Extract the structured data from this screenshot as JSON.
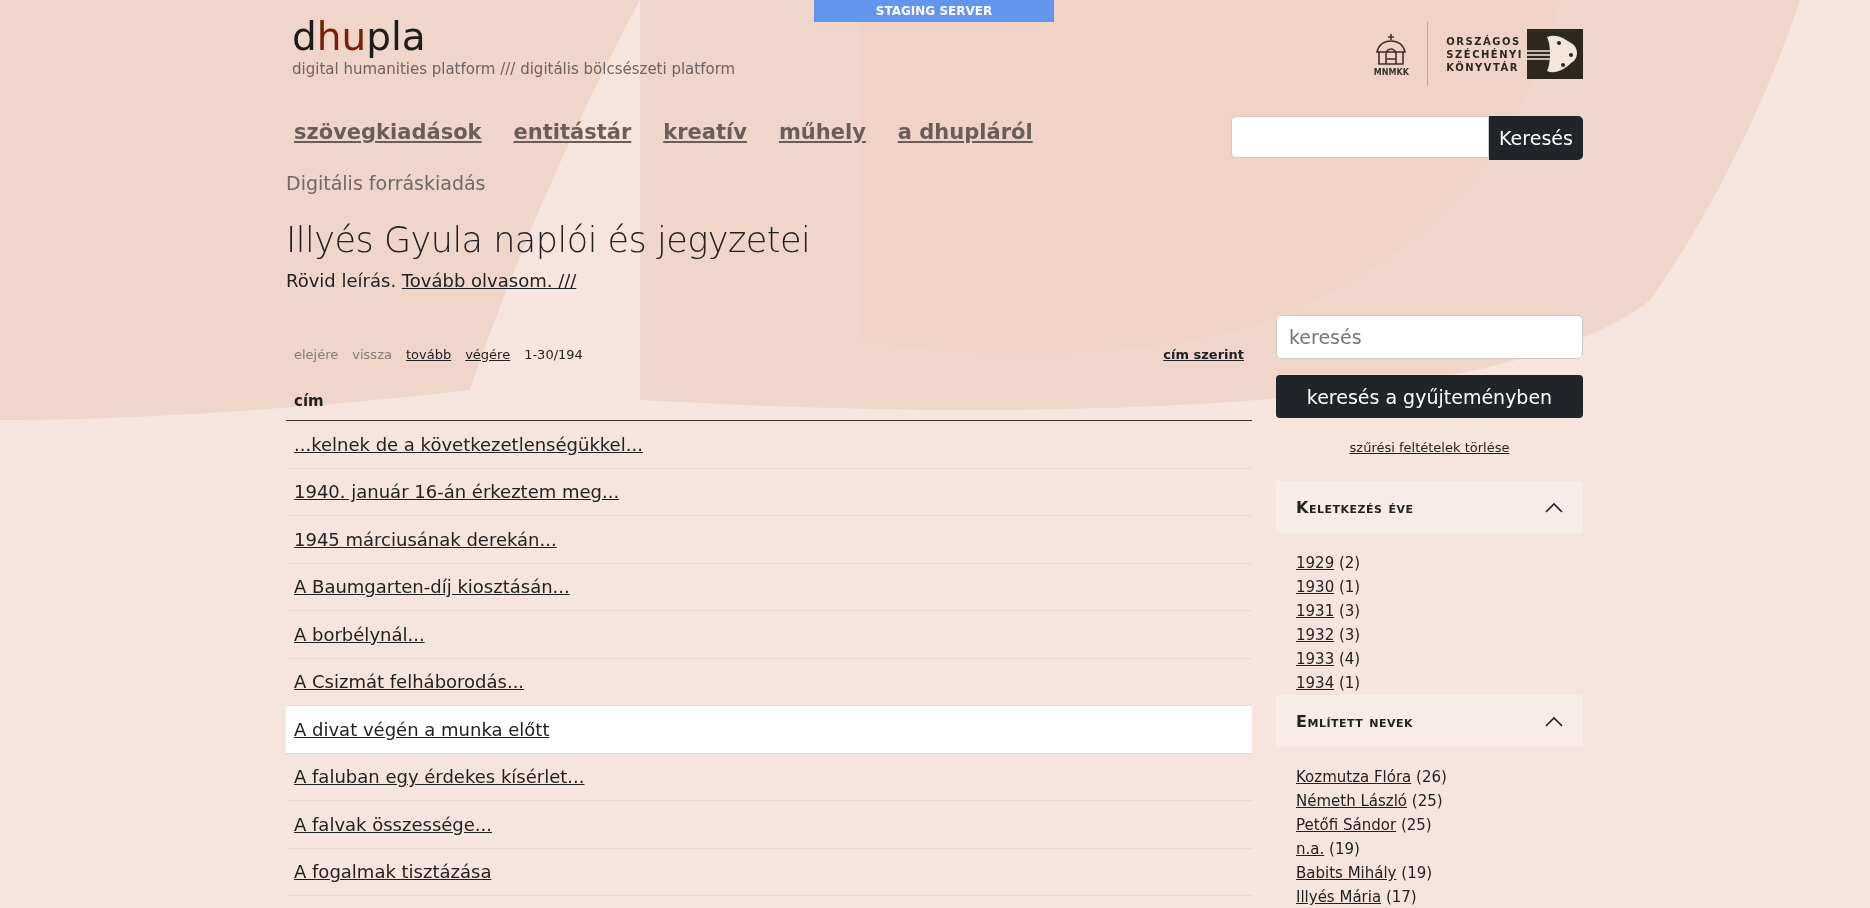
{
  "staging_banner": "STAGING SERVER",
  "logo": {
    "parts": [
      {
        "text": "d",
        "accent": false
      },
      {
        "text": "hu",
        "accent": true
      },
      {
        "text": "pla",
        "accent": false
      }
    ],
    "tagline": "digital humanities platform /// digitális bölcsészeti platform"
  },
  "partner_logos": [
    {
      "kind": "mnmkk",
      "label": "MNMKK"
    },
    {
      "kind": "oszk",
      "lines": [
        "ORSZÁGOS",
        "SZÉCHÉNYI",
        "KÖNYVTÁR"
      ]
    }
  ],
  "nav": [
    "szövegkiadások",
    "entitástár",
    "kreatív",
    "műhely",
    "a dhupláról"
  ],
  "header_search": {
    "button": "Keresés"
  },
  "breadcrumb": "Digitális forráskiadás",
  "title": "Illyés Gyula naplói és jegyzetei",
  "description": {
    "text": "Rövid leírás.",
    "link": "Tovább olvasom. ///"
  },
  "pagination": [
    {
      "label": "elejére",
      "disabled": true
    },
    {
      "label": "vissza",
      "disabled": true
    },
    {
      "label": "tovább",
      "disabled": false
    },
    {
      "label": "végére",
      "disabled": false
    }
  ],
  "page_range": "1-30/194",
  "sort": "cím szerint",
  "table": {
    "column": "cím",
    "rows": [
      {
        "title": "...kelnek de a következetlenségükkel...",
        "highlighted": false
      },
      {
        "title": "1940. január 16-án érkeztem meg...",
        "highlighted": false
      },
      {
        "title": "1945 márciusának derekán...",
        "highlighted": false
      },
      {
        "title": "A Baumgarten-díj kiosztásán...",
        "highlighted": false
      },
      {
        "title": "A borbélynál...",
        "highlighted": false
      },
      {
        "title": "A Csizmát felháborodás...",
        "highlighted": false
      },
      {
        "title": "A divat végén a munka előtt",
        "highlighted": true
      },
      {
        "title": "A faluban egy érdekes kísérlet...",
        "highlighted": false
      },
      {
        "title": "A falvak összessége...",
        "highlighted": false
      },
      {
        "title": "A fogalmak tisztázása",
        "highlighted": false
      }
    ]
  },
  "sidebar": {
    "search_placeholder": "keresés",
    "search_button": "keresés a gyűjteményben",
    "clear_filters": "szűrési feltételek törlése",
    "facets": [
      {
        "title": "Keletkezés éve",
        "expanded": true,
        "items": [
          {
            "label": "1929",
            "count": "(2)"
          },
          {
            "label": "1930",
            "count": "(1)"
          },
          {
            "label": "1931",
            "count": "(3)"
          },
          {
            "label": "1932",
            "count": "(3)"
          },
          {
            "label": "1933",
            "count": "(4)"
          },
          {
            "label": "1934",
            "count": "(1)"
          }
        ]
      },
      {
        "title": "Említett nevek",
        "expanded": true,
        "items": [
          {
            "label": "Kozmutza Flóra",
            "count": "(26)"
          },
          {
            "label": "Németh László",
            "count": "(25)"
          },
          {
            "label": "Petőfi Sándor",
            "count": "(25)"
          },
          {
            "label": "n.a.",
            "count": "(19)"
          },
          {
            "label": "Babits Mihály",
            "count": "(19)"
          },
          {
            "label": "Illyés Mária",
            "count": "(17)"
          }
        ]
      }
    ]
  }
}
